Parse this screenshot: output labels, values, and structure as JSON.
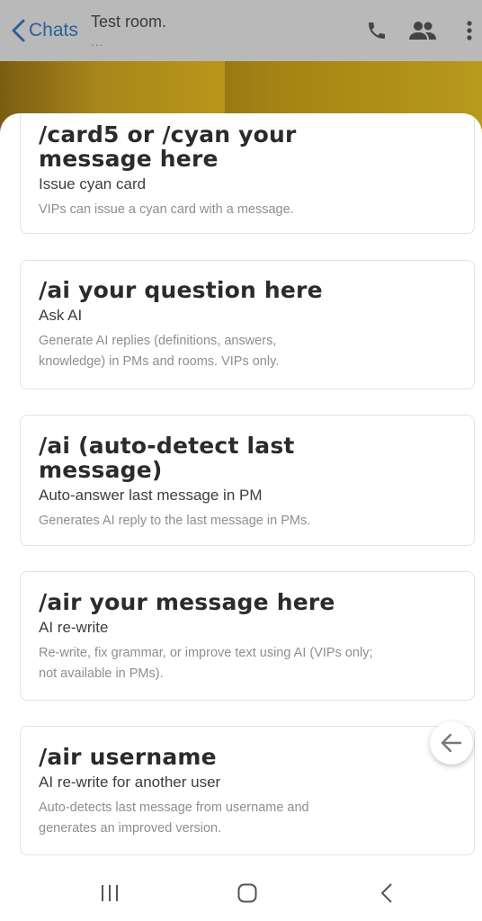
{
  "header": {
    "back_label": "Chats",
    "room_title": "Test room.",
    "room_subtitle": "...",
    "icons": [
      "chevron-left-icon",
      "phone-icon",
      "people-icon",
      "more-vertical-icon"
    ]
  },
  "commands": [
    {
      "command": "/card5 or /cyan your message here",
      "title": "Issue cyan card",
      "description": "VIPs can issue a cyan card with a message."
    },
    {
      "command": "/ai your question here",
      "title": "Ask AI",
      "description": "Generate AI replies (definitions, answers, knowledge) in PMs and rooms. VIPs only."
    },
    {
      "command": "/ai (auto-detect last message)",
      "title": "Auto-answer last message in PM",
      "description": "Generates AI reply to the last message in PMs."
    },
    {
      "command": "/air your message here",
      "title": "AI re-write",
      "description": "Re-write, fix grammar, or improve text using AI (VIPs only; not available in PMs)."
    },
    {
      "command": "/air username",
      "title": "AI re-write for another user",
      "description": "Auto-detects last message from username and generates an improved version."
    }
  ],
  "navbar": {
    "icons": [
      "recent-apps-icon",
      "home-icon",
      "back-icon"
    ]
  },
  "colors": {
    "accent": "#2c5f9a",
    "header_dim": "#b9b9b9",
    "command_text": "#2b2b2b",
    "description_text": "#8e8e8e"
  }
}
